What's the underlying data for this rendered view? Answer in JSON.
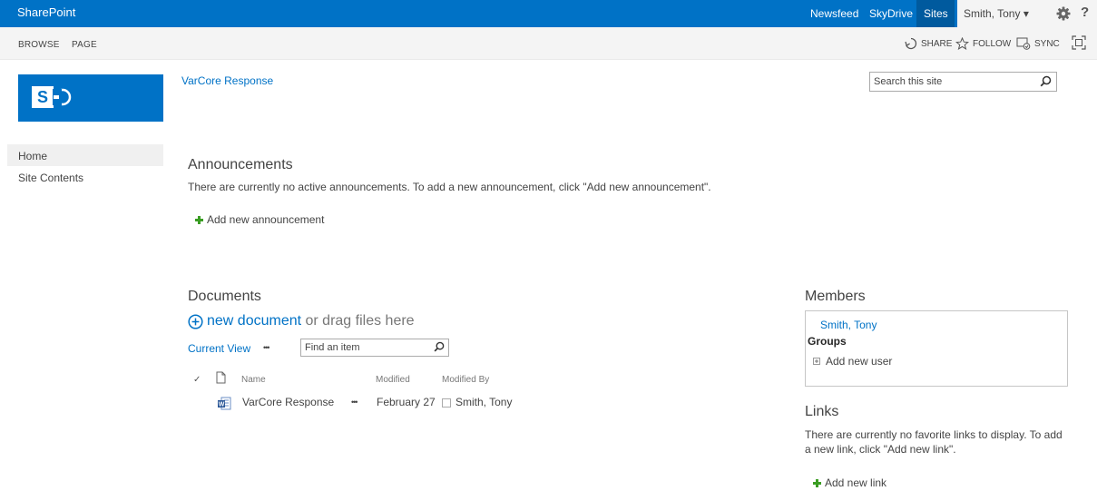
{
  "suite": {
    "brand": "SharePoint",
    "links": [
      "Newsfeed",
      "SkyDrive",
      "Sites"
    ],
    "user": "Smith, Tony",
    "user_caret": "▾",
    "help": "?"
  },
  "ribbon": {
    "tabs": [
      "BROWSE",
      "PAGE"
    ],
    "actions": {
      "share": "SHARE",
      "follow": "FOLLOW",
      "sync": "SYNC"
    }
  },
  "site": {
    "title": "VarCore Response"
  },
  "search": {
    "placeholder": "Search this site"
  },
  "nav": {
    "items": [
      "Home",
      "Site Contents"
    ]
  },
  "announcements": {
    "title": "Announcements",
    "message": "There are currently no active announcements. To add a new announcement, click \"Add new announcement\".",
    "add_label": "Add new announcement"
  },
  "documents": {
    "title": "Documents",
    "new_link": "new document",
    "new_suffix": " or drag files here",
    "current_view": "Current View",
    "ellipsis": "•••",
    "find_placeholder": "Find an item",
    "columns": {
      "check": "✓",
      "name": "Name",
      "modified": "Modified",
      "modified_by": "Modified By"
    },
    "rows": [
      {
        "name": "VarCore Response",
        "modified": "February 27",
        "modified_by": "Smith, Tony"
      }
    ]
  },
  "members": {
    "title": "Members",
    "member": "Smith, Tony",
    "groups_label": "Groups",
    "add_user": "Add new user"
  },
  "links": {
    "title": "Links",
    "message": "There are currently no favorite links to display. To add a new link, click \"Add new link\".",
    "add_label": "Add new link"
  },
  "colors": {
    "brand": "#0072c6",
    "sites_tab": "#005a9e",
    "add_icon": "#3a9d23"
  }
}
